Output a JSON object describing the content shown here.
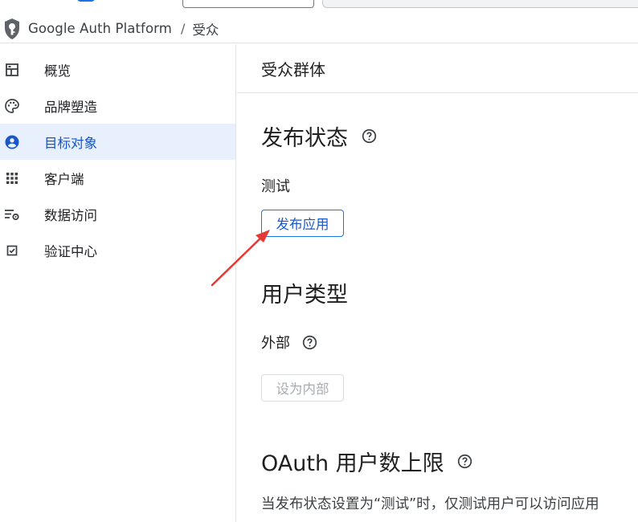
{
  "breadcrumb": {
    "app_name": "Google Auth Platform",
    "separator": "/",
    "current": "受众"
  },
  "sidebar": {
    "items": [
      {
        "label": "概览",
        "icon": "dashboard-icon",
        "active": false
      },
      {
        "label": "品牌塑造",
        "icon": "palette-icon",
        "active": false
      },
      {
        "label": "目标对象",
        "icon": "account-circle-icon",
        "active": true
      },
      {
        "label": "客户端",
        "icon": "apps-grid-icon",
        "active": false
      },
      {
        "label": "数据访问",
        "icon": "data-settings-icon",
        "active": false
      },
      {
        "label": "验证中心",
        "icon": "checkbox-icon",
        "active": false
      }
    ]
  },
  "main": {
    "header_title": "受众群体",
    "publishing_status": {
      "title": "发布状态",
      "status_value": "测试",
      "publish_button": "发布应用"
    },
    "user_type": {
      "title": "用户类型",
      "value": "外部",
      "make_internal_button": "设为内部"
    },
    "oauth_limit": {
      "title": "OAuth 用户数上限",
      "description": "当发布状态设置为“测试”时，仅测试用户可以访问应用"
    }
  },
  "colors": {
    "accent": "#1a73e8",
    "active_bg": "#e8f0fe",
    "annotation_arrow": "#e53935"
  }
}
